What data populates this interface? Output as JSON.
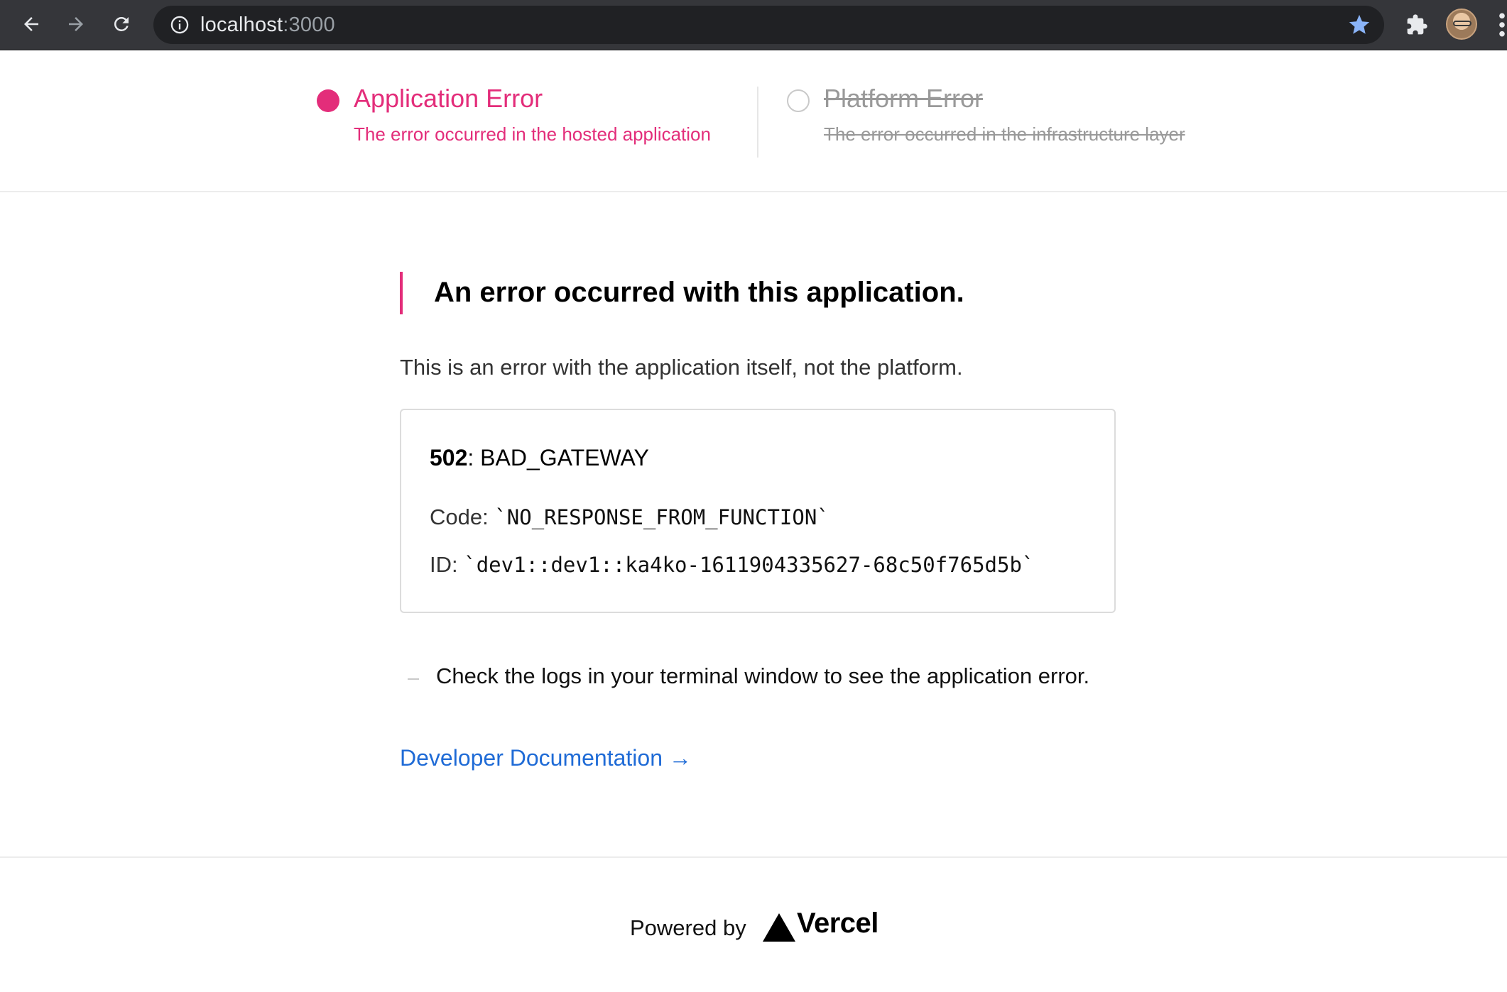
{
  "browser": {
    "url_host": "localhost",
    "url_port": ":3000",
    "icons": {
      "back": "arrow-left-icon",
      "forward": "arrow-right-icon",
      "reload": "reload-icon",
      "site_info": "info-icon",
      "bookmark": "star-icon",
      "extensions": "puzzle-icon",
      "menu": "more-vert-icon"
    },
    "bookmark_color": "#8ab4f8"
  },
  "error_types": {
    "application": {
      "title": "Application Error",
      "subtitle": "The error occurred in the hosted application",
      "active": true,
      "color": "#e32d7a"
    },
    "platform": {
      "title": "Platform Error",
      "subtitle": "The error occurred in the infrastructure layer",
      "active": false
    }
  },
  "main": {
    "heading": "An error occurred with this application.",
    "description": "This is an error with the application itself, not the platform.",
    "error": {
      "status_code": "502",
      "status_sep": ": ",
      "status_text": "BAD_GATEWAY",
      "code_label": "Code: ",
      "code_value": "`NO_RESPONSE_FROM_FUNCTION`",
      "id_label": "ID: ",
      "id_value": "`dev1::dev1::ka4ko-1611904335627-68c50f765d5b`"
    },
    "hint": "Check the logs in your terminal window to see the application error.",
    "docs_link": "Developer Documentation →",
    "link_color": "#1f6bd6"
  },
  "footer": {
    "powered_by": "Powered by",
    "brand": "Vercel"
  }
}
